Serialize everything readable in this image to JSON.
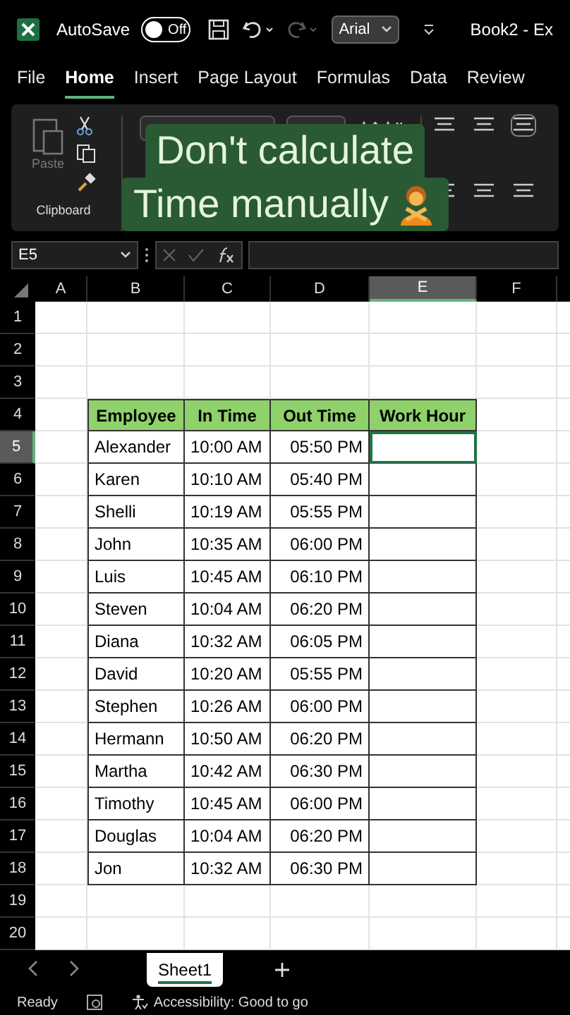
{
  "title_bar": {
    "autosave_label": "AutoSave",
    "autosave_toggle": {
      "on": false,
      "label": "Off"
    },
    "font_box": "Arial",
    "document_title": "Book2 - Ex"
  },
  "ribbon_tabs": [
    {
      "label": "File",
      "selected": false
    },
    {
      "label": "Home",
      "selected": true
    },
    {
      "label": "Insert",
      "selected": false
    },
    {
      "label": "Page Layout",
      "selected": false
    },
    {
      "label": "Formulas",
      "selected": false
    },
    {
      "label": "Data",
      "selected": false
    },
    {
      "label": "Review",
      "selected": false
    }
  ],
  "ribbon": {
    "paste_label": "Paste",
    "paste_disabled": true,
    "group_label": "Clipboard"
  },
  "caption": {
    "lines": [
      "Don't calculate",
      "Time manually"
    ]
  },
  "formula_bar": {
    "name_box": "E5"
  },
  "sheet": {
    "columns": [
      {
        "label": "A",
        "selected": false
      },
      {
        "label": "B",
        "selected": false
      },
      {
        "label": "C",
        "selected": false
      },
      {
        "label": "D",
        "selected": false
      },
      {
        "label": "E",
        "selected": true
      },
      {
        "label": "F",
        "selected": false
      }
    ],
    "row_numbers": [
      {
        "label": "1",
        "selected": false
      },
      {
        "label": "2",
        "selected": false
      },
      {
        "label": "3",
        "selected": false
      },
      {
        "label": "4",
        "selected": false
      },
      {
        "label": "5",
        "selected": true
      },
      {
        "label": "6",
        "selected": false
      },
      {
        "label": "7",
        "selected": false
      },
      {
        "label": "8",
        "selected": false
      },
      {
        "label": "9",
        "selected": false
      },
      {
        "label": "10",
        "selected": false
      },
      {
        "label": "11",
        "selected": false
      },
      {
        "label": "12",
        "selected": false
      },
      {
        "label": "13",
        "selected": false
      },
      {
        "label": "14",
        "selected": false
      },
      {
        "label": "15",
        "selected": false
      },
      {
        "label": "16",
        "selected": false
      },
      {
        "label": "17",
        "selected": false
      },
      {
        "label": "18",
        "selected": false
      },
      {
        "label": "19",
        "selected": false
      },
      {
        "label": "20",
        "selected": false
      }
    ]
  },
  "table": {
    "header": [
      "Employee",
      "In Time",
      "Out Time",
      "Work Hour"
    ],
    "rows": [
      {
        "employee": "Alexander",
        "in_time": "10:00 AM",
        "out_time": "05:50 PM",
        "work_hour_selected": true
      },
      {
        "employee": "Karen",
        "in_time": "10:10 AM",
        "out_time": "05:40 PM",
        "work_hour_selected": false
      },
      {
        "employee": "Shelli",
        "in_time": "10:19 AM",
        "out_time": "05:55 PM",
        "work_hour_selected": false
      },
      {
        "employee": "John",
        "in_time": "10:35 AM",
        "out_time": "06:00 PM",
        "work_hour_selected": false
      },
      {
        "employee": "Luis",
        "in_time": "10:45 AM",
        "out_time": "06:10 PM",
        "work_hour_selected": false
      },
      {
        "employee": "Steven",
        "in_time": "10:04 AM",
        "out_time": "06:20 PM",
        "work_hour_selected": false
      },
      {
        "employee": "Diana",
        "in_time": "10:32 AM",
        "out_time": "06:05 PM",
        "work_hour_selected": false
      },
      {
        "employee": "David",
        "in_time": "10:20 AM",
        "out_time": "05:55 PM",
        "work_hour_selected": false
      },
      {
        "employee": "Stephen",
        "in_time": "10:26 AM",
        "out_time": "06:00 PM",
        "work_hour_selected": false
      },
      {
        "employee": "Hermann",
        "in_time": "10:50 AM",
        "out_time": "06:20 PM",
        "work_hour_selected": false
      },
      {
        "employee": "Martha",
        "in_time": "10:42 AM",
        "out_time": "06:30 PM",
        "work_hour_selected": false
      },
      {
        "employee": "Timothy",
        "in_time": "10:45 AM",
        "out_time": "06:00 PM",
        "work_hour_selected": false
      },
      {
        "employee": "Douglas",
        "in_time": "10:04 AM",
        "out_time": "06:20 PM",
        "work_hour_selected": false
      },
      {
        "employee": "Jon",
        "in_time": "10:32 AM",
        "out_time": "06:30 PM",
        "work_hour_selected": false
      }
    ]
  },
  "sheet_tabs": [
    {
      "label": "Sheet1",
      "selected": true
    }
  ],
  "status_bar": {
    "status": "Ready",
    "accessibility": "Accessibility: Good to go"
  }
}
